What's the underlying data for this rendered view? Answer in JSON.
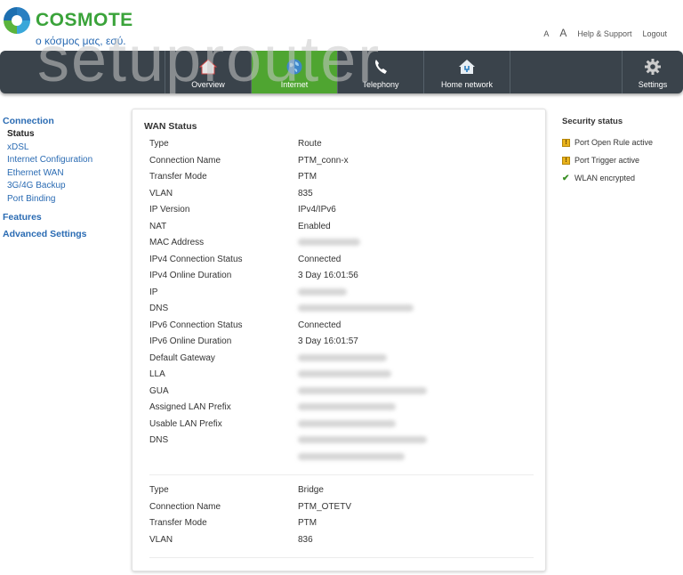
{
  "brand": {
    "name": "COSMOTE",
    "tagline": "ο κόσμος μας, εσύ.",
    "color": "#3aa33a",
    "tagline_color": "#2a6bb3"
  },
  "watermark": "setuprouter",
  "top_links": {
    "font_small": "A",
    "font_large": "A",
    "help": "Help & Support",
    "logout": "Logout"
  },
  "nav": {
    "active_color": "#4fa531",
    "bar_color": "#3a434b",
    "items": [
      {
        "label": "Overview",
        "icon": "house-icon",
        "active": false
      },
      {
        "label": "Internet",
        "icon": "globe-icon",
        "active": true
      },
      {
        "label": "Telephony",
        "icon": "phone-icon",
        "active": false
      },
      {
        "label": "Home network",
        "icon": "home-network-icon",
        "active": false
      },
      {
        "label": "Settings",
        "icon": "gear-icon",
        "active": false
      }
    ]
  },
  "sidebar": {
    "connection": "Connection",
    "items": [
      "Status",
      "xDSL",
      "Internet Configuration",
      "Ethernet WAN",
      "3G/4G Backup",
      "Port Binding"
    ],
    "current": "Status",
    "features": "Features",
    "advanced": "Advanced Settings"
  },
  "wan": {
    "title": "WAN Status",
    "connection1": [
      {
        "label": "Type",
        "value": "Route"
      },
      {
        "label": "Connection Name",
        "value": "PTM_conn-x"
      },
      {
        "label": "Transfer Mode",
        "value": "PTM"
      },
      {
        "label": "VLAN",
        "value": "835"
      },
      {
        "label": "IP Version",
        "value": "IPv4/IPv6"
      },
      {
        "label": "NAT",
        "value": "Enabled"
      },
      {
        "label": "MAC Address",
        "value": null
      },
      {
        "label": "IPv4 Connection Status",
        "value": "Connected"
      },
      {
        "label": "IPv4 Online Duration",
        "value": "3 Day 16:01:56"
      },
      {
        "label": "IP",
        "value": null
      },
      {
        "label": "DNS",
        "value": null
      },
      {
        "label": "IPv6 Connection Status",
        "value": "Connected"
      },
      {
        "label": "IPv6 Online Duration",
        "value": "3 Day 16:01:57"
      },
      {
        "label": "Default Gateway",
        "value": null
      },
      {
        "label": "LLA",
        "value": null
      },
      {
        "label": "GUA",
        "value": null
      },
      {
        "label": "Assigned LAN Prefix",
        "value": null
      },
      {
        "label": "Usable LAN Prefix",
        "value": null
      },
      {
        "label": "DNS",
        "value": null
      },
      {
        "label": "",
        "value": null
      }
    ],
    "connection2": [
      {
        "label": "Type",
        "value": "Bridge"
      },
      {
        "label": "Connection Name",
        "value": "PTM_OTETV"
      },
      {
        "label": "Transfer Mode",
        "value": "PTM"
      },
      {
        "label": "VLAN",
        "value": "836"
      }
    ]
  },
  "security": {
    "title": "Security status",
    "items": [
      {
        "label": "Port Open Rule active",
        "status": "warning"
      },
      {
        "label": "Port Trigger active",
        "status": "warning"
      },
      {
        "label": "WLAN encrypted",
        "status": "ok"
      }
    ]
  }
}
